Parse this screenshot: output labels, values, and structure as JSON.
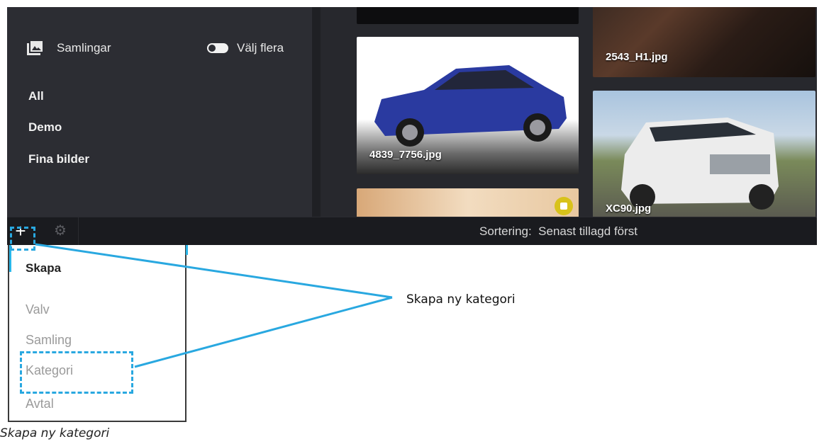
{
  "sidebar": {
    "collections_label": "Samlingar",
    "select_multiple_label": "Välj flera",
    "items": [
      "All",
      "Demo",
      "Fina bilder"
    ]
  },
  "gallery": {
    "thumbnails": [
      {
        "label": ""
      },
      {
        "label": "2543_H1.jpg"
      },
      {
        "label": "4839_7756.jpg"
      },
      {
        "label": "XC90.jpg"
      },
      {
        "label": ""
      }
    ]
  },
  "bottom_bar": {
    "add_icon": "plus-icon",
    "settings_icon": "gear-icon",
    "sort_text": "Sortering:  Senast tillagd först"
  },
  "dropdown": {
    "title": "Skapa",
    "items": [
      "Valv",
      "Samling",
      "Kategori",
      "Avtal"
    ]
  },
  "callout": "Skapa ny kategori",
  "caption": "Skapa ny kategori",
  "colors": {
    "accent": "#29a8e0",
    "sidebar_bg": "#2c2d33",
    "app_bg": "#1a1b1f"
  }
}
